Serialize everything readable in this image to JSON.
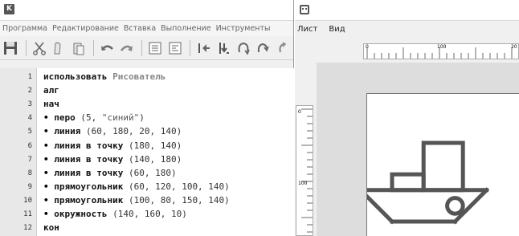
{
  "editor_window": {
    "app_icon_letter": "K",
    "menu": [
      "Программа",
      "Редактирование",
      "Вставка",
      "Выполнение",
      "Инструменты"
    ],
    "toolbar_icons": [
      "save-icon",
      "cut-icon",
      "copy-icon",
      "paste-icon",
      "undo-icon",
      "redo-icon",
      "comment-icon",
      "uncomment-icon",
      "step-icon",
      "run-icon",
      "step-into-icon",
      "step-out-icon",
      "run-all-icon"
    ],
    "lines": [
      {
        "n": "1",
        "kw": "использовать",
        "rest": "Рисователь",
        "rest_class": "lib"
      },
      {
        "n": "2",
        "kw": "алг",
        "rest": "",
        "rest_class": "arg"
      },
      {
        "n": "3",
        "kw": "нач",
        "rest": "",
        "rest_class": "arg"
      },
      {
        "n": "4",
        "bullet": "•",
        "kw": "перо",
        "rest": "(5, ",
        "str": "\"синий\"",
        "tail": ")"
      },
      {
        "n": "5",
        "bullet": "•",
        "kw": "линия",
        "rest": "(60, 180, 20, 140)"
      },
      {
        "n": "6",
        "bullet": "•",
        "kw": "линия в точку",
        "rest": "(180, 140)"
      },
      {
        "n": "7",
        "bullet": "•",
        "kw": "линия в точку",
        "rest": "(140, 180)"
      },
      {
        "n": "8",
        "bullet": "•",
        "kw": "линия в точку",
        "rest": "(60, 180)"
      },
      {
        "n": "9",
        "bullet": "•",
        "kw": "прямоугольник",
        "rest": "(60, 120, 100, 140)"
      },
      {
        "n": "10",
        "bullet": "•",
        "kw": "прямоугольник",
        "rest": "(100, 80, 150, 140)"
      },
      {
        "n": "11",
        "bullet": "•",
        "kw": "окружность",
        "rest": "(140, 160, 10)"
      },
      {
        "n": "12",
        "kw": "кон",
        "rest": "",
        "rest_class": "arg"
      }
    ]
  },
  "painter_window": {
    "menu": [
      "Лист",
      "Вид"
    ],
    "h_ruler_labels": [
      "0",
      "100",
      "20"
    ],
    "v_ruler_labels": [
      "0",
      "100"
    ],
    "drawing": {
      "pen_color": "#555555",
      "pen_width": 5,
      "lines": [
        [
          60,
          180,
          20,
          140
        ],
        [
          20,
          140,
          180,
          140
        ],
        [
          180,
          140,
          140,
          180
        ],
        [
          140,
          180,
          60,
          180
        ]
      ],
      "rects": [
        [
          60,
          120,
          100,
          140
        ],
        [
          100,
          80,
          150,
          140
        ]
      ],
      "circle": [
        140,
        160,
        10
      ]
    }
  }
}
